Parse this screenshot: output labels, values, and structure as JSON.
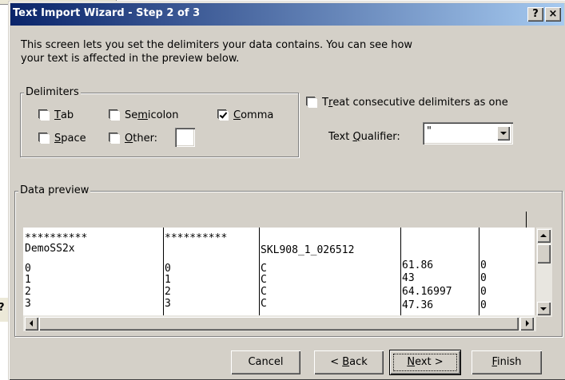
{
  "window": {
    "title": "Text Import Wizard - Step 2 of 3",
    "help_label": "?",
    "close_label": "×"
  },
  "background_glyph": "?",
  "description": "This screen lets you set the delimiters your data contains.  You can see how your text is affected in the preview below.",
  "delimiters": {
    "group_label": "Delimiters",
    "tab": {
      "label_pre": "",
      "label_key": "T",
      "label_post": "ab",
      "checked": false
    },
    "semicolon": {
      "label_pre": "Se",
      "label_key": "m",
      "label_post": "icolon",
      "checked": false
    },
    "comma": {
      "label_pre": "",
      "label_key": "C",
      "label_post": "omma",
      "checked": true
    },
    "space": {
      "label_pre": "",
      "label_key": "S",
      "label_post": "pace",
      "checked": false
    },
    "other": {
      "label_pre": "",
      "label_key": "O",
      "label_post": "ther:",
      "checked": false,
      "value": ""
    }
  },
  "consecutive": {
    "label_pre": "T",
    "label_key": "r",
    "label_post": "eat consecutive delimiters as one",
    "checked": false
  },
  "qualifier": {
    "label_pre": "Text ",
    "label_key": "Q",
    "label_post": "ualifier:",
    "value": "\""
  },
  "preview": {
    "group_label": "Data preview",
    "columns": [
      {
        "cells": [
          "**********",
          "DemoSS2x",
          "0",
          "1",
          "2",
          "3"
        ]
      },
      {
        "cells": [
          "**********",
          "",
          "0",
          "1",
          "2",
          "3"
        ]
      },
      {
        "cells": [
          "",
          "SKL908_1_026512",
          "C",
          "C",
          "C",
          "C"
        ]
      },
      {
        "cells": [
          "",
          "",
          "61.86",
          "43",
          "64.16997",
          "47.36"
        ]
      },
      {
        "cells": [
          "",
          "",
          "0",
          "0",
          "0",
          "0"
        ]
      }
    ]
  },
  "buttons": {
    "cancel": "Cancel",
    "back_pre": "< ",
    "back_key": "B",
    "back_post": "ack",
    "next_pre": "",
    "next_key": "N",
    "next_post": "ext >",
    "finish_pre": "",
    "finish_key": "F",
    "finish_post": "inish"
  }
}
